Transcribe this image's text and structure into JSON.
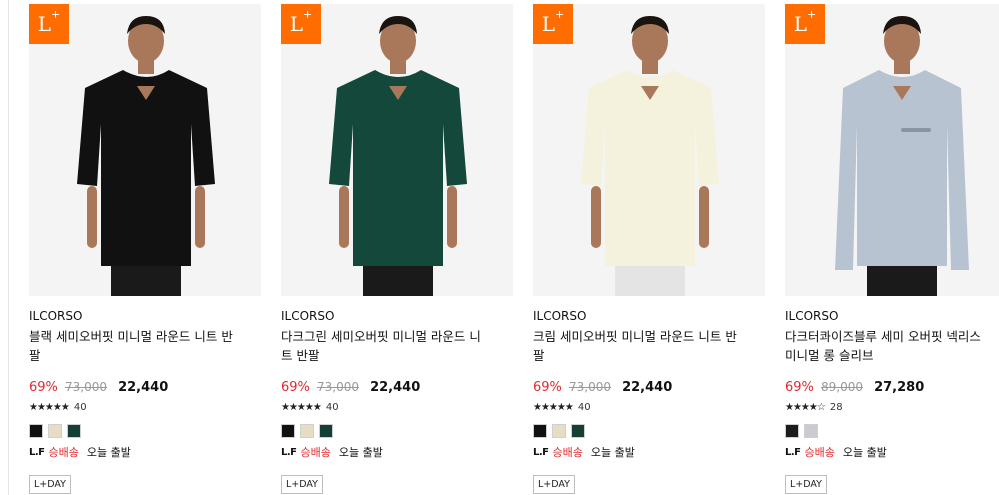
{
  "badge": {
    "main": "L",
    "sup": "+"
  },
  "products": [
    {
      "brand": "ILCORSO",
      "name_line1": "블랙 세미오버핏 미니멀 라운드 니트 반",
      "name_line2": "팔",
      "discount": "69%",
      "original_price": "73,000",
      "price": "22,440",
      "stars": "★★★★★",
      "reviews": "40",
      "swatches": [
        "#111111",
        "#e7dcc6",
        "#153f35"
      ],
      "shipping_logo": "L.F",
      "shipping_fast": "승배송",
      "shipping_today": "오늘 출발",
      "tag": "L+DAY",
      "shirt_color": "#111111"
    },
    {
      "brand": "ILCORSO",
      "name_line1": "다크그린 세미오버핏 미니멀 라운드 니",
      "name_line2": "트 반팔",
      "discount": "69%",
      "original_price": "73,000",
      "price": "22,440",
      "stars": "★★★★★",
      "reviews": "40",
      "swatches": [
        "#111111",
        "#e7dcc6",
        "#153f35"
      ],
      "shipping_logo": "L.F",
      "shipping_fast": "승배송",
      "shipping_today": "오늘 출발",
      "tag": "L+DAY",
      "shirt_color": "#14483a"
    },
    {
      "brand": "ILCORSO",
      "name_line1": "크림 세미오버핏 미니멀 라운드 니트 반",
      "name_line2": "팔",
      "discount": "69%",
      "original_price": "73,000",
      "price": "22,440",
      "stars": "★★★★★",
      "reviews": "40",
      "swatches": [
        "#111111",
        "#e7dcc6",
        "#153f35"
      ],
      "shipping_logo": "L.F",
      "shipping_fast": "승배송",
      "shipping_today": "오늘 출발",
      "tag": "L+DAY",
      "shirt_color": "#f4f2dd"
    },
    {
      "brand": "ILCORSO",
      "name_line1": "다크터콰이즈블루 세미 오버핏 넥리스",
      "name_line2": "미니멀 롱 슬리브",
      "discount": "69%",
      "original_price": "89,000",
      "price": "27,280",
      "stars": "★★★★☆",
      "reviews": "28",
      "swatches": [
        "#1c1c1c",
        "#c9cbd0"
      ],
      "shipping_logo": "L.F",
      "shipping_fast": "승배송",
      "shipping_today": "오늘 출발",
      "tag": "L+DAY",
      "shirt_color": "#b8c3d2"
    }
  ]
}
